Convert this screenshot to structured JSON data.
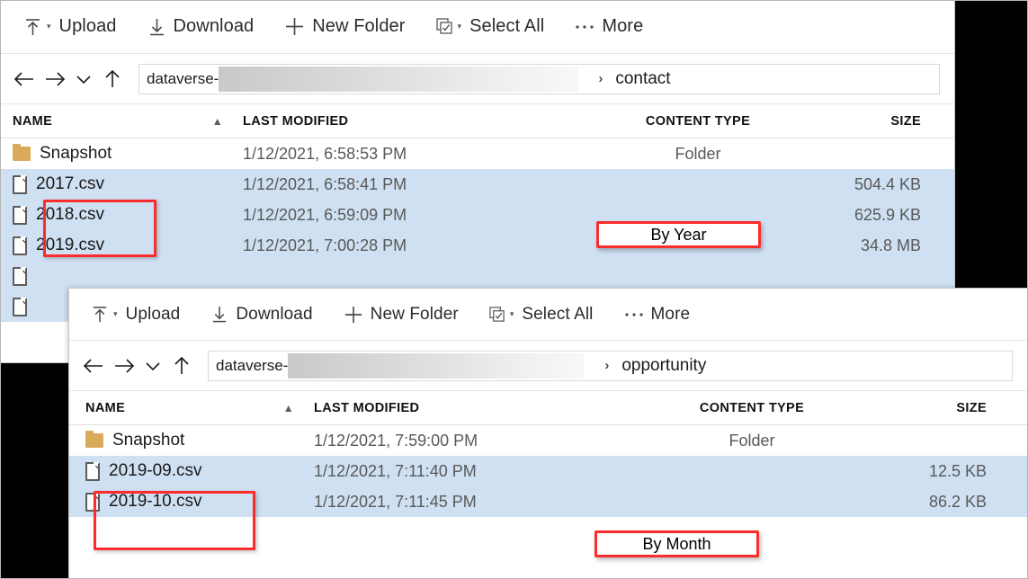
{
  "panels": [
    {
      "id": "contact",
      "toolbar": [
        {
          "label": "Upload",
          "icon": "upload-icon",
          "has_caret": true
        },
        {
          "label": "Download",
          "icon": "download-icon",
          "has_caret": false
        },
        {
          "label": "New Folder",
          "icon": "plus-icon",
          "has_caret": false
        },
        {
          "label": "Select All",
          "icon": "select-all-icon",
          "has_caret": true
        },
        {
          "label": "More",
          "icon": "ellipsis-icon",
          "has_caret": false
        }
      ],
      "nav": {
        "back_icon": "arrow-left-icon",
        "forward_icon": "arrow-right-icon",
        "history_icon": "chevron-down-icon",
        "up_icon": "arrow-up-icon"
      },
      "breadcrumb": {
        "root": "dataverse-",
        "redacted": "",
        "separator": "›",
        "current": "contact"
      },
      "columns": [
        "NAME",
        "LAST MODIFIED",
        "CONTENT TYPE",
        "SIZE"
      ],
      "sort": {
        "column": "NAME",
        "direction": "ascending",
        "icon": "chevron-up-icon"
      },
      "rows": [
        {
          "name": "Snapshot",
          "icon": "folder-icon",
          "modified": "1/12/2021, 6:58:53 PM",
          "type": "Folder",
          "size": "",
          "selected": false
        },
        {
          "name": "2017.csv",
          "icon": "document-icon",
          "modified": "1/12/2021, 6:58:41 PM",
          "type": "",
          "size": "504.4 KB",
          "selected": true
        },
        {
          "name": "2018.csv",
          "icon": "document-icon",
          "modified": "1/12/2021, 6:59:09 PM",
          "type": "",
          "size": "625.9 KB",
          "selected": true
        },
        {
          "name": "2019.csv",
          "icon": "document-icon",
          "modified": "1/12/2021, 7:00:28 PM",
          "type": "",
          "size": "34.8 MB",
          "selected": true
        },
        {
          "name": "",
          "icon": "document-icon",
          "modified": "",
          "type": "",
          "size": "",
          "selected": true
        },
        {
          "name": "",
          "icon": "document-icon",
          "modified": "",
          "type": "",
          "size": "",
          "selected": true
        }
      ]
    },
    {
      "id": "opportunity",
      "toolbar": [
        {
          "label": "Upload",
          "icon": "upload-icon",
          "has_caret": true
        },
        {
          "label": "Download",
          "icon": "download-icon",
          "has_caret": false
        },
        {
          "label": "New Folder",
          "icon": "plus-icon",
          "has_caret": false
        },
        {
          "label": "Select All",
          "icon": "select-all-icon",
          "has_caret": true
        },
        {
          "label": "More",
          "icon": "ellipsis-icon",
          "has_caret": false
        }
      ],
      "nav": {
        "back_icon": "arrow-left-icon",
        "forward_icon": "arrow-right-icon",
        "history_icon": "chevron-down-icon",
        "up_icon": "arrow-up-icon"
      },
      "breadcrumb": {
        "root": "dataverse-",
        "redacted": "",
        "separator": "›",
        "current": "opportunity"
      },
      "columns": [
        "NAME",
        "LAST MODIFIED",
        "CONTENT TYPE",
        "SIZE"
      ],
      "sort": {
        "column": "NAME",
        "direction": "ascending",
        "icon": "chevron-up-icon"
      },
      "rows": [
        {
          "name": "Snapshot",
          "icon": "folder-icon",
          "modified": "1/12/2021, 7:59:00 PM",
          "type": "Folder",
          "size": "",
          "selected": false
        },
        {
          "name": "2019-09.csv",
          "icon": "document-icon",
          "modified": "1/12/2021, 7:11:40 PM",
          "type": "",
          "size": "12.5 KB",
          "selected": true
        },
        {
          "name": "2019-10.csv",
          "icon": "document-icon",
          "modified": "1/12/2021, 7:11:45 PM",
          "type": "",
          "size": "86.2 KB",
          "selected": true
        }
      ]
    }
  ],
  "annotations": {
    "callout_year": "By Year",
    "callout_month": "By Month",
    "highlight_color": "#fb2c2c",
    "selection_color": "#cfe0f2"
  }
}
